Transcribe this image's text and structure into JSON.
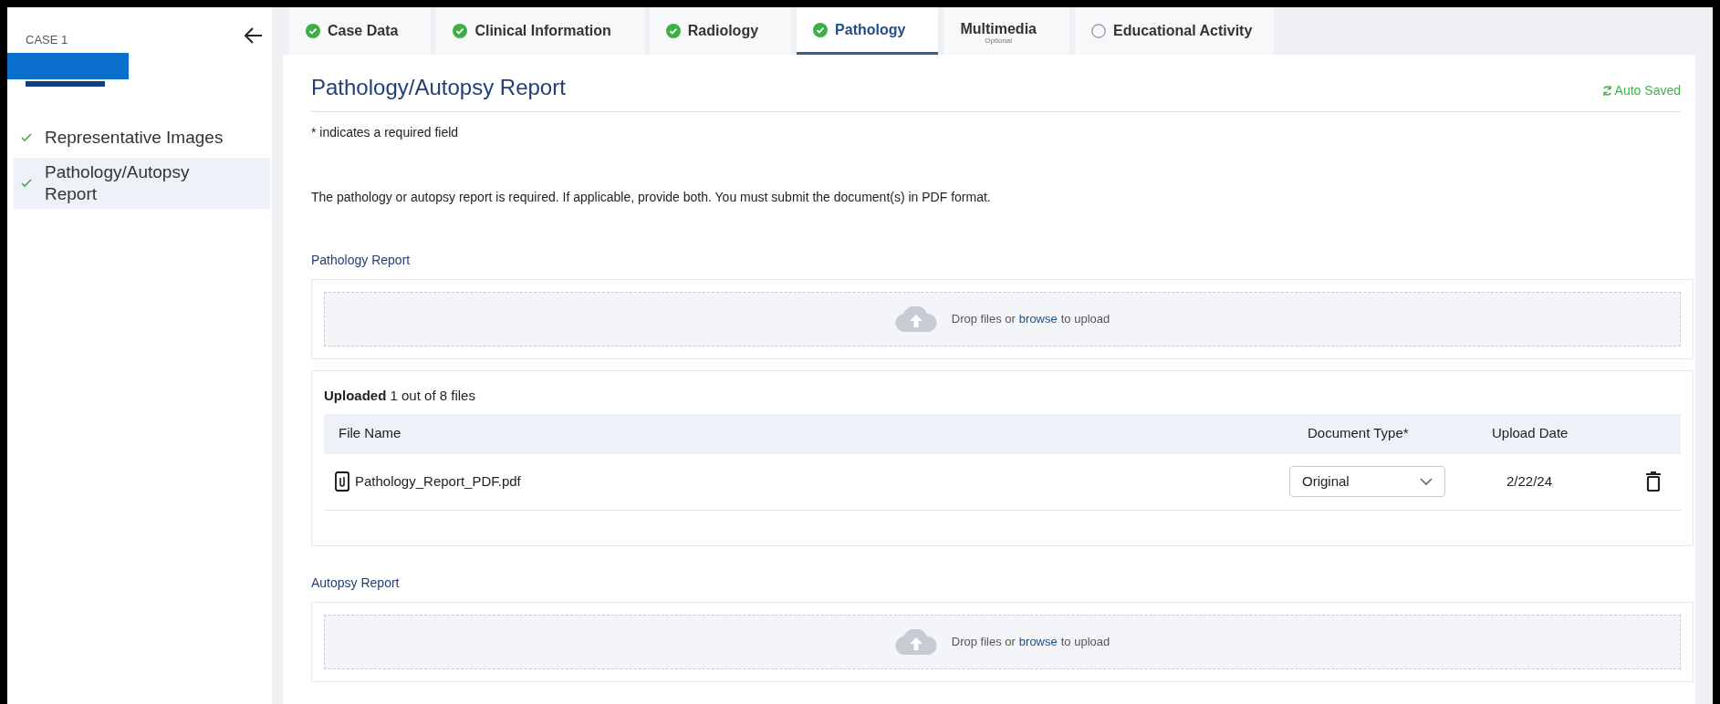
{
  "sidebar": {
    "case_label": "CASE 1",
    "items": [
      {
        "label": "Representative Images",
        "checked": true,
        "selected": false
      },
      {
        "label": "Pathology/Autopsy Report",
        "checked": true,
        "selected": true
      }
    ]
  },
  "tabs": [
    {
      "label": "Case Data",
      "kind": "complete",
      "selected": false
    },
    {
      "label": "Clinical Information",
      "kind": "complete",
      "selected": false
    },
    {
      "label": "Radiology",
      "kind": "complete",
      "selected": false
    },
    {
      "label": "Pathology",
      "kind": "complete",
      "selected": true
    },
    {
      "label": "Multimedia",
      "kind": "optional",
      "sublabel": "Optional",
      "selected": false
    },
    {
      "label": "Educational Activity",
      "kind": "incomplete",
      "selected": false
    }
  ],
  "page": {
    "title": "Pathology/Autopsy Report",
    "status": "Auto Saved",
    "required_note": "* indicates a required field",
    "instructions": "The pathology or autopsy report is required. If applicable, provide both. You must submit the document(s) in PDF format.",
    "sections": [
      {
        "title": "Pathology Report",
        "dropzone": {
          "before": "Drop files or",
          "link": "browse",
          "after": "to upload"
        },
        "uploads": {
          "summary": "**Uploaded** 1 out of 8 files",
          "columns": [
            "File Name",
            "Document Type*",
            "Upload Date"
          ],
          "rows": [
            {
              "file_name": "Pathology_Report_PDF.pdf",
              "document_type": "Original",
              "upload_date": "2/22/24"
            }
          ]
        }
      },
      {
        "title": "Autopsy Report",
        "dropzone": {
          "before": "Drop files or",
          "link": "browse",
          "after": "to upload"
        }
      }
    ]
  }
}
